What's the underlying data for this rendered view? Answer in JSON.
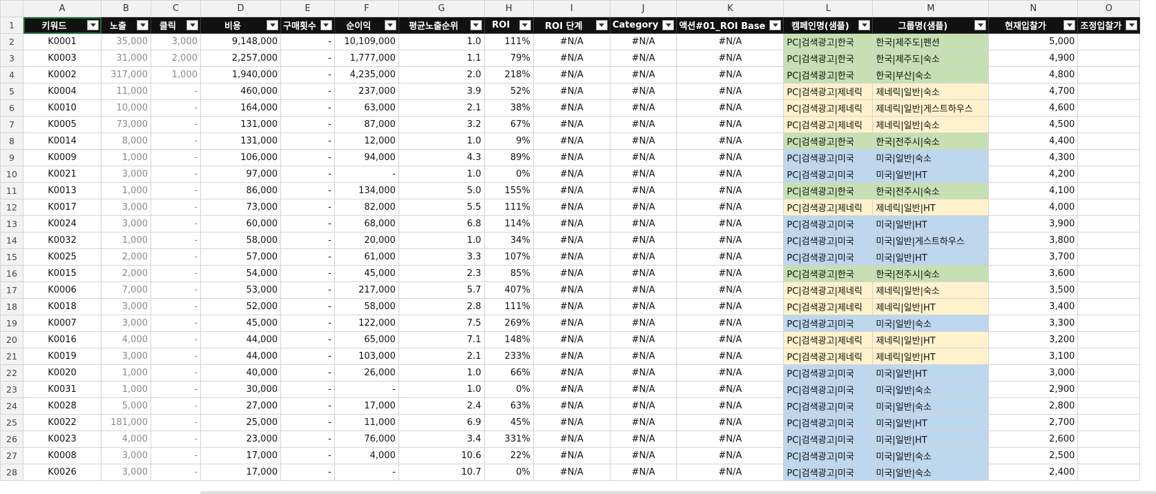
{
  "columns": [
    {
      "letter": "A",
      "width": 113,
      "header": "키워드",
      "align": "ctr"
    },
    {
      "letter": "B",
      "width": 72,
      "header": "노출",
      "align": "num",
      "gray": true
    },
    {
      "letter": "C",
      "width": 72,
      "header": "클릭",
      "align": "num",
      "gray": true
    },
    {
      "letter": "D",
      "width": 116,
      "header": "비용",
      "align": "num"
    },
    {
      "letter": "E",
      "width": 72,
      "header": "구매횟수",
      "align": "num"
    },
    {
      "letter": "F",
      "width": 93,
      "header": "순이익",
      "align": "num"
    },
    {
      "letter": "G",
      "width": 124,
      "header": "평균노출순위",
      "align": "num"
    },
    {
      "letter": "H",
      "width": 71,
      "header": "ROI",
      "align": "num"
    },
    {
      "letter": "I",
      "width": 111,
      "header": "ROI 단계",
      "align": "ctr"
    },
    {
      "letter": "J",
      "width": 66,
      "header": "Category",
      "align": "ctr"
    },
    {
      "letter": "K",
      "width": 118,
      "header": "액션#01_ROI Base",
      "align": "ctr"
    },
    {
      "letter": "L",
      "width": 129,
      "header": "캠페인명(샘플)",
      "align": "left",
      "tint": true
    },
    {
      "letter": "M",
      "width": 168,
      "header": "그룹명(샘플)",
      "align": "left",
      "tint": true
    },
    {
      "letter": "N",
      "width": 129,
      "header": "현재입찰가",
      "align": "num"
    },
    {
      "letter": "O",
      "width": 84,
      "header": "조정입찰가",
      "align": "num"
    }
  ],
  "rows": [
    {
      "num": "2",
      "cells": [
        "K0001",
        "35,000",
        "3,000",
        "9,148,000",
        "-",
        "10,109,000",
        "1.0",
        "111%",
        "#N/A",
        "#N/A",
        "#N/A",
        "PC|검색광고|한국",
        "한국|제주도|펜션",
        "5,000",
        ""
      ],
      "group": "kr"
    },
    {
      "num": "3",
      "cells": [
        "K0003",
        "31,000",
        "2,000",
        "2,257,000",
        "-",
        "1,777,000",
        "1.1",
        "79%",
        "#N/A",
        "#N/A",
        "#N/A",
        "PC|검색광고|한국",
        "한국|제주도|숙소",
        "4,900",
        ""
      ],
      "group": "kr"
    },
    {
      "num": "4",
      "cells": [
        "K0002",
        "317,000",
        "1,000",
        "1,940,000",
        "-",
        "4,235,000",
        "2.0",
        "218%",
        "#N/A",
        "#N/A",
        "#N/A",
        "PC|검색광고|한국",
        "한국|부산|숙소",
        "4,800",
        ""
      ],
      "group": "kr"
    },
    {
      "num": "5",
      "cells": [
        "K0004",
        "11,000",
        "-",
        "460,000",
        "-",
        "237,000",
        "3.9",
        "52%",
        "#N/A",
        "#N/A",
        "#N/A",
        "PC|검색광고|제네릭",
        "제네릭|일반|숙소",
        "4,700",
        ""
      ],
      "group": "gen"
    },
    {
      "num": "6",
      "cells": [
        "K0010",
        "10,000",
        "-",
        "164,000",
        "-",
        "63,000",
        "2.1",
        "38%",
        "#N/A",
        "#N/A",
        "#N/A",
        "PC|검색광고|제네릭",
        "제네릭|일반|게스트하우스",
        "4,600",
        ""
      ],
      "group": "gen"
    },
    {
      "num": "7",
      "cells": [
        "K0005",
        "73,000",
        "-",
        "131,000",
        "-",
        "87,000",
        "3.2",
        "67%",
        "#N/A",
        "#N/A",
        "#N/A",
        "PC|검색광고|제네릭",
        "제네릭|일반|숙소",
        "4,500",
        ""
      ],
      "group": "gen"
    },
    {
      "num": "8",
      "cells": [
        "K0014",
        "8,000",
        "-",
        "131,000",
        "-",
        "12,000",
        "1.0",
        "9%",
        "#N/A",
        "#N/A",
        "#N/A",
        "PC|검색광고|한국",
        "한국|전주시|숙소",
        "4,400",
        ""
      ],
      "group": "kr"
    },
    {
      "num": "9",
      "cells": [
        "K0009",
        "1,000",
        "-",
        "106,000",
        "-",
        "94,000",
        "4.3",
        "89%",
        "#N/A",
        "#N/A",
        "#N/A",
        "PC|검색광고|미국",
        "미국|일반|숙소",
        "4,300",
        ""
      ],
      "group": "us"
    },
    {
      "num": "10",
      "cells": [
        "K0021",
        "3,000",
        "-",
        "97,000",
        "-",
        "-",
        "1.0",
        "0%",
        "#N/A",
        "#N/A",
        "#N/A",
        "PC|검색광고|미국",
        "미국|일반|HT",
        "4,200",
        ""
      ],
      "group": "us"
    },
    {
      "num": "11",
      "cells": [
        "K0013",
        "1,000",
        "-",
        "86,000",
        "-",
        "134,000",
        "5.0",
        "155%",
        "#N/A",
        "#N/A",
        "#N/A",
        "PC|검색광고|한국",
        "한국|전주시|숙소",
        "4,100",
        ""
      ],
      "group": "kr"
    },
    {
      "num": "12",
      "cells": [
        "K0017",
        "3,000",
        "-",
        "73,000",
        "-",
        "82,000",
        "5.5",
        "111%",
        "#N/A",
        "#N/A",
        "#N/A",
        "PC|검색광고|제네릭",
        "제네릭|일반|HT",
        "4,000",
        ""
      ],
      "group": "gen"
    },
    {
      "num": "13",
      "cells": [
        "K0024",
        "3,000",
        "-",
        "60,000",
        "-",
        "68,000",
        "6.8",
        "114%",
        "#N/A",
        "#N/A",
        "#N/A",
        "PC|검색광고|미국",
        "미국|일반|HT",
        "3,900",
        ""
      ],
      "group": "us"
    },
    {
      "num": "14",
      "cells": [
        "K0032",
        "1,000",
        "-",
        "58,000",
        "-",
        "20,000",
        "1.0",
        "34%",
        "#N/A",
        "#N/A",
        "#N/A",
        "PC|검색광고|미국",
        "미국|일반|게스트하우스",
        "3,800",
        ""
      ],
      "group": "us"
    },
    {
      "num": "15",
      "cells": [
        "K0025",
        "2,000",
        "-",
        "57,000",
        "-",
        "61,000",
        "3.3",
        "107%",
        "#N/A",
        "#N/A",
        "#N/A",
        "PC|검색광고|미국",
        "미국|일반|HT",
        "3,700",
        ""
      ],
      "group": "us"
    },
    {
      "num": "16",
      "cells": [
        "K0015",
        "2,000",
        "-",
        "54,000",
        "-",
        "45,000",
        "2.3",
        "85%",
        "#N/A",
        "#N/A",
        "#N/A",
        "PC|검색광고|한국",
        "한국|전주시|숙소",
        "3,600",
        ""
      ],
      "group": "kr"
    },
    {
      "num": "17",
      "cells": [
        "K0006",
        "7,000",
        "-",
        "53,000",
        "-",
        "217,000",
        "5.7",
        "407%",
        "#N/A",
        "#N/A",
        "#N/A",
        "PC|검색광고|제네릭",
        "제네릭|일반|숙소",
        "3,500",
        ""
      ],
      "group": "gen"
    },
    {
      "num": "18",
      "cells": [
        "K0018",
        "3,000",
        "-",
        "52,000",
        "-",
        "58,000",
        "2.8",
        "111%",
        "#N/A",
        "#N/A",
        "#N/A",
        "PC|검색광고|제네릭",
        "제네릭|일반|HT",
        "3,400",
        ""
      ],
      "group": "gen"
    },
    {
      "num": "19",
      "cells": [
        "K0007",
        "3,000",
        "-",
        "45,000",
        "-",
        "122,000",
        "7.5",
        "269%",
        "#N/A",
        "#N/A",
        "#N/A",
        "PC|검색광고|미국",
        "미국|일반|숙소",
        "3,300",
        ""
      ],
      "group": "us"
    },
    {
      "num": "20",
      "cells": [
        "K0016",
        "4,000",
        "-",
        "44,000",
        "-",
        "65,000",
        "7.1",
        "148%",
        "#N/A",
        "#N/A",
        "#N/A",
        "PC|검색광고|제네릭",
        "제네릭|일반|HT",
        "3,200",
        ""
      ],
      "group": "gen"
    },
    {
      "num": "21",
      "cells": [
        "K0019",
        "3,000",
        "-",
        "44,000",
        "-",
        "103,000",
        "2.1",
        "233%",
        "#N/A",
        "#N/A",
        "#N/A",
        "PC|검색광고|제네릭",
        "제네릭|일반|HT",
        "3,100",
        ""
      ],
      "group": "gen"
    },
    {
      "num": "22",
      "cells": [
        "K0020",
        "1,000",
        "-",
        "40,000",
        "-",
        "26,000",
        "1.0",
        "66%",
        "#N/A",
        "#N/A",
        "#N/A",
        "PC|검색광고|미국",
        "미국|일반|HT",
        "3,000",
        ""
      ],
      "group": "us"
    },
    {
      "num": "23",
      "cells": [
        "K0031",
        "1,000",
        "-",
        "30,000",
        "-",
        "-",
        "1.0",
        "0%",
        "#N/A",
        "#N/A",
        "#N/A",
        "PC|검색광고|미국",
        "미국|일반|숙소",
        "2,900",
        ""
      ],
      "group": "us"
    },
    {
      "num": "24",
      "cells": [
        "K0028",
        "5,000",
        "-",
        "27,000",
        "-",
        "17,000",
        "2.4",
        "63%",
        "#N/A",
        "#N/A",
        "#N/A",
        "PC|검색광고|미국",
        "미국|일반|숙소",
        "2,800",
        ""
      ],
      "group": "us"
    },
    {
      "num": "25",
      "cells": [
        "K0022",
        "181,000",
        "-",
        "25,000",
        "-",
        "11,000",
        "6.9",
        "45%",
        "#N/A",
        "#N/A",
        "#N/A",
        "PC|검색광고|미국",
        "미국|일반|HT",
        "2,700",
        ""
      ],
      "group": "us"
    },
    {
      "num": "26",
      "cells": [
        "K0023",
        "4,000",
        "-",
        "23,000",
        "-",
        "76,000",
        "3.4",
        "331%",
        "#N/A",
        "#N/A",
        "#N/A",
        "PC|검색광고|미국",
        "미국|일반|HT",
        "2,600",
        ""
      ],
      "group": "us"
    },
    {
      "num": "27",
      "cells": [
        "K0008",
        "3,000",
        "-",
        "17,000",
        "-",
        "4,000",
        "10.6",
        "22%",
        "#N/A",
        "#N/A",
        "#N/A",
        "PC|검색광고|미국",
        "미국|일반|숙소",
        "2,500",
        ""
      ],
      "group": "us"
    },
    {
      "num": "28",
      "cells": [
        "K0026",
        "3,000",
        "-",
        "17,000",
        "-",
        "-",
        "10.7",
        "0%",
        "#N/A",
        "#N/A",
        "#N/A",
        "PC|검색광고|미국",
        "미국|일반|숙소",
        "2,400",
        ""
      ],
      "group": "us"
    }
  ],
  "header_row_num": "1",
  "selected_cell": "A1"
}
